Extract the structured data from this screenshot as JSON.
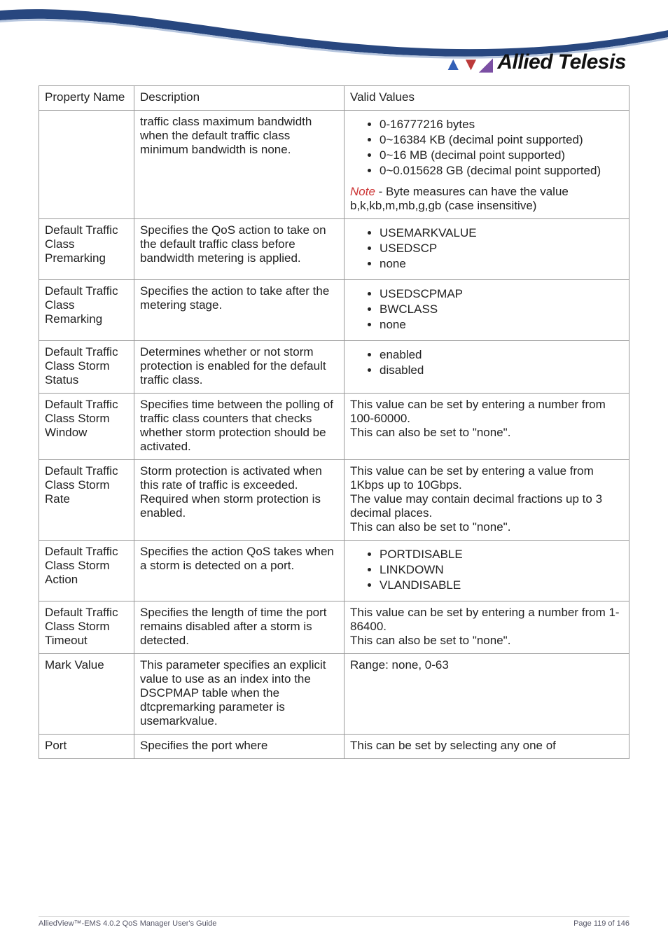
{
  "brand": "Allied Telesis",
  "header": {
    "col1": "Property Name",
    "col2": "Description",
    "col3": "Valid Values"
  },
  "rows": {
    "r0": {
      "desc": "traffic class maximum bandwidth when the default traffic class minimum bandwidth is none.",
      "b1": "0-16777216 bytes",
      "b2": "0~16384 KB (decimal point supported)",
      "b3": "0~16 MB (decimal point supported)",
      "b4": "0~0.015628 GB (decimal point supported)",
      "note_label": "Note",
      "note_rest": " - Byte measures can have the value b,k,kb,m,mb,g,gb (case insensitive)"
    },
    "r1": {
      "name": "Default Traffic Class Premarking",
      "desc": "Specifies the QoS action to take on the default traffic class before bandwidth metering is applied.",
      "b1": "USEMARKVALUE",
      "b2": "USEDSCP",
      "b3": "none"
    },
    "r2": {
      "name": "Default Traffic Class Remarking",
      "desc": "Specifies the action to take after the metering stage.",
      "b1": "USEDSCPMAP",
      "b2": "BWCLASS",
      "b3": "none"
    },
    "r3": {
      "name": "Default Traffic Class Storm Status",
      "desc": "Determines whether or not storm protection is enabled for the default traffic class.",
      "b1": "enabled",
      "b2": "disabled"
    },
    "r4": {
      "name": "Default Traffic Class Storm Window",
      "desc": "Specifies time between the polling of traffic class counters that checks whether storm protection should be activated.",
      "valid": "This value can be set by entering a number from 100-60000.\nThis can also be set to \"none\"."
    },
    "r5": {
      "name": "Default Traffic Class Storm Rate",
      "desc": "Storm protection is activated when this rate of traffic is exceeded. Required when storm protection is enabled.",
      "valid": "This value can be set by entering a value from 1Kbps up to 10Gbps.\nThe value may contain decimal fractions up to 3 decimal places.\nThis can also be set to \"none\"."
    },
    "r6": {
      "name": "Default Traffic Class Storm Action",
      "desc": "Specifies the action QoS takes when a storm is detected on a port.",
      "b1": "PORTDISABLE",
      "b2": "LINKDOWN",
      "b3": "VLANDISABLE"
    },
    "r7": {
      "name": "Default Traffic Class Storm Timeout",
      "desc": "Specifies the length of time the port remains disabled after a storm is detected.",
      "valid": "This value can be set by entering a number from 1-86400.\nThis can also be set to \"none\"."
    },
    "r8": {
      "name": "Mark Value",
      "desc": "This parameter specifies an explicit value to use as an index into the DSCPMAP table when the dtcpremarking parameter is usemarkvalue.",
      "valid": "Range: none, 0-63"
    },
    "r9": {
      "name": "Port",
      "desc": "Specifies the port where",
      "valid": "This can be set by selecting any one of"
    }
  },
  "footer": {
    "left": "AlliedView™-EMS 4.0.2 QoS Manager User's Guide",
    "right": "Page 119 of 146"
  }
}
